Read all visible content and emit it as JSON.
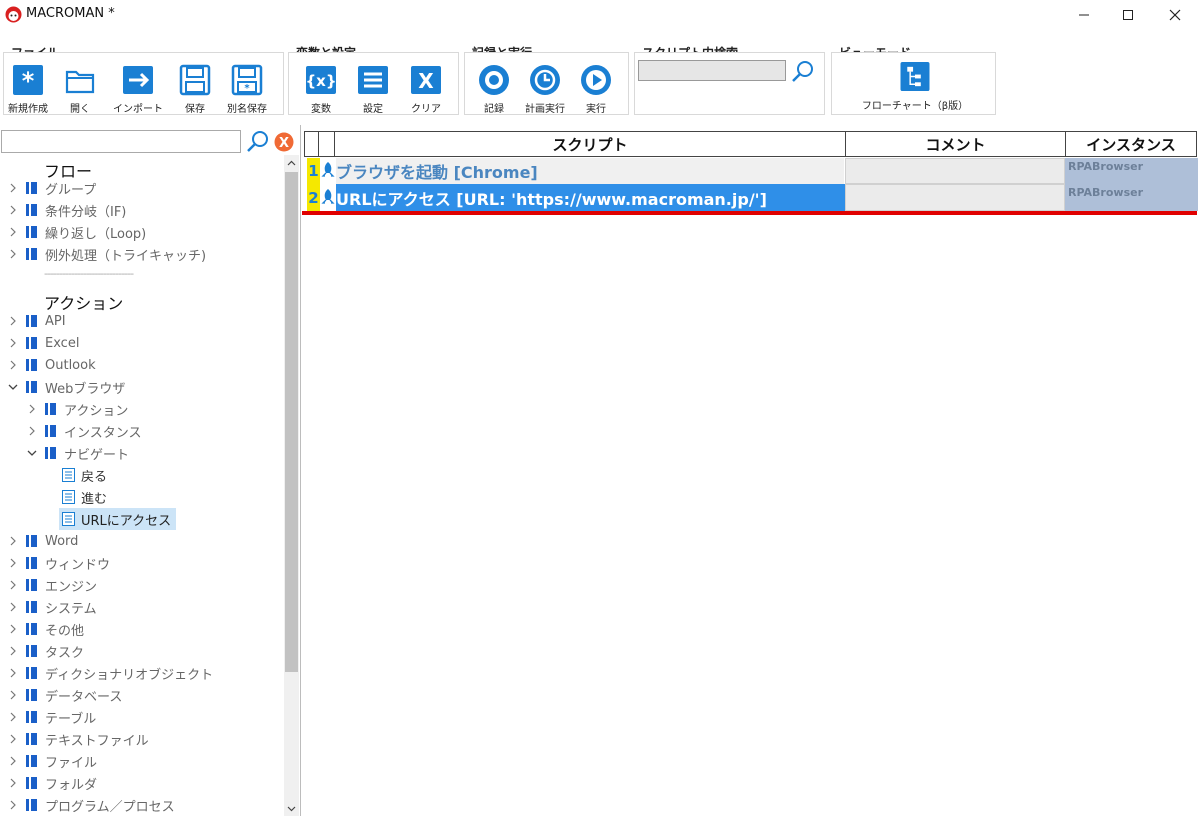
{
  "window": {
    "title": "MACROMAN *",
    "controls": [
      "minimize-icon",
      "maximize-icon",
      "close-icon"
    ]
  },
  "ribbon": {
    "file": {
      "label": "ファイル",
      "buttons": {
        "new": "新規作成",
        "open": "開く",
        "import": "インポート",
        "save": "保存",
        "save_as": "別名保存"
      }
    },
    "vars": {
      "label": "変数と設定",
      "buttons": {
        "variables": "変数",
        "settings": "設定",
        "clear": "クリア"
      }
    },
    "record": {
      "label": "記録と実行",
      "buttons": {
        "record": "記録",
        "schedule": "計画実行",
        "run": "実行"
      }
    },
    "search": {
      "label": "スクリプト内検索",
      "value": ""
    },
    "view": {
      "label": "ビューモード",
      "flowchart": "フローチャート（β版）"
    }
  },
  "tree": {
    "search_value": "",
    "flow_title": "フロー",
    "flow": [
      "グループ",
      "条件分岐（IF)",
      "繰り返し（Loop)",
      "例外処理（トライキャッチ)"
    ],
    "separator": "------------------------------",
    "action_title": "アクション",
    "actions_top": [
      "API",
      "Excel",
      "Outlook"
    ],
    "web": {
      "label": "Webブラウザ",
      "children": [
        "アクション",
        "インスタンス"
      ],
      "navigate": {
        "label": "ナビゲート",
        "children": [
          "戻る",
          "進む",
          "URLにアクセス"
        ]
      }
    },
    "actions_bottom": [
      "Word",
      "ウィンドウ",
      "エンジン",
      "システム",
      "その他",
      "タスク",
      "ディクショナリオブジェクト",
      "データベース",
      "テーブル",
      "テキストファイル",
      "ファイル",
      "フォルダ",
      "プログラム／プロセス"
    ]
  },
  "grid": {
    "headers": {
      "script": "スクリプト",
      "comment": "コメント",
      "instance": "インスタンス"
    },
    "rows": [
      {
        "num": "1",
        "script": "ブラウザを起動 [Chrome]",
        "comment": "",
        "instance": "RPABrowser"
      },
      {
        "num": "2",
        "script": "URLにアクセス [URL: 'https://www.macroman.jp/']",
        "comment": "",
        "instance": "RPABrowser"
      }
    ]
  },
  "colors": {
    "accent": "#1a7fd3",
    "selected_row": "#2f8fe8",
    "row_number": "#f5e800",
    "instance_bg": "#aebfd8",
    "drop_line": "#e00000",
    "tree_selected": "#cce4f7",
    "clear_icon": "#f06a35"
  }
}
